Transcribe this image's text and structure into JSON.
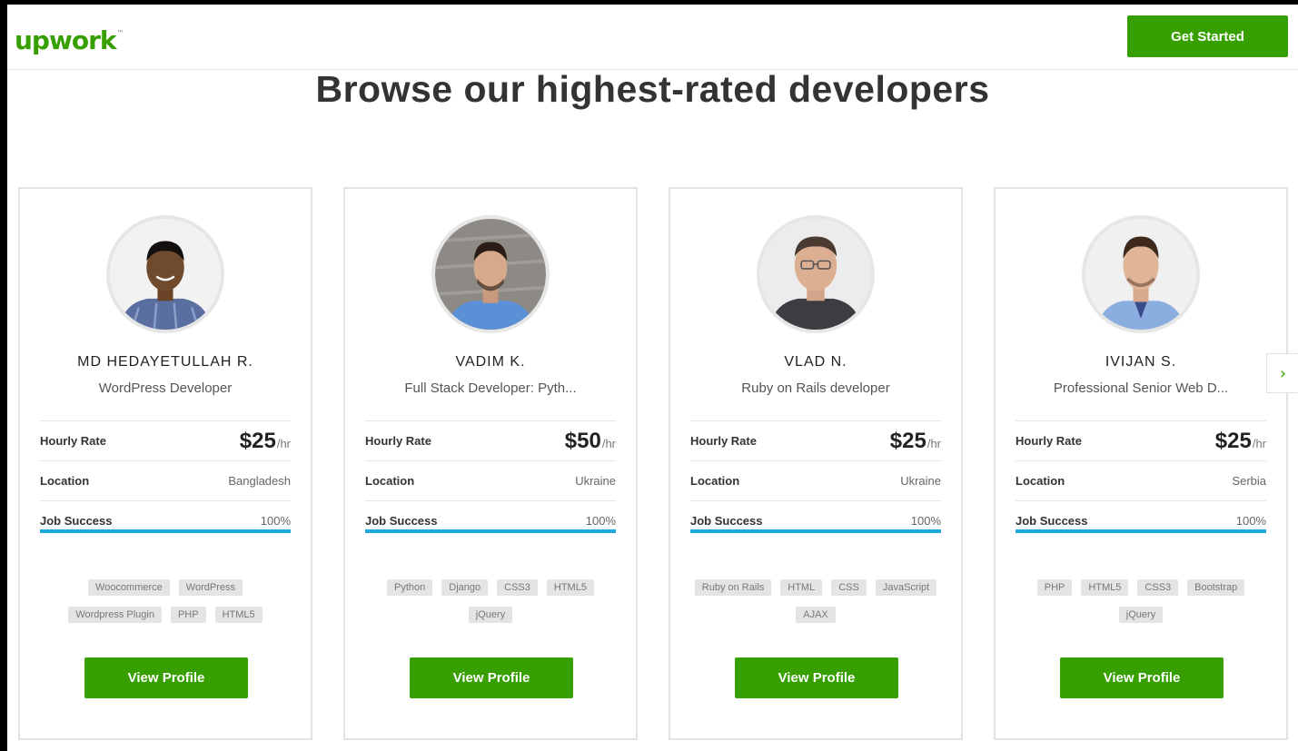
{
  "header": {
    "logo_text": "upwork",
    "logo_tm": "™",
    "cta_label": "Get Started"
  },
  "title": "Browse our highest-rated developers",
  "labels": {
    "hourly_rate": "Hourly Rate",
    "location": "Location",
    "job_success": "Job Success",
    "per_hour": "/hr",
    "view_profile": "View Profile"
  },
  "carousel": {
    "next_glyph": "›"
  },
  "developers": [
    {
      "name": "MD HEDAYETULLAH R.",
      "role": "WordPress Developer",
      "rate": "$25",
      "location": "Bangladesh",
      "job_success": "100%",
      "job_success_fraction": 1.0,
      "skills": [
        "Woocommerce",
        "WordPress",
        "Wordpress Plugin",
        "PHP",
        "HTML5"
      ]
    },
    {
      "name": "VADIM K.",
      "role": "Full Stack Developer: Pyth...",
      "rate": "$50",
      "location": "Ukraine",
      "job_success": "100%",
      "job_success_fraction": 1.0,
      "skills": [
        "Python",
        "Django",
        "CSS3",
        "HTML5",
        "jQuery"
      ]
    },
    {
      "name": "VLAD N.",
      "role": "Ruby on Rails developer",
      "rate": "$25",
      "location": "Ukraine",
      "job_success": "100%",
      "job_success_fraction": 1.0,
      "skills": [
        "Ruby on Rails",
        "HTML",
        "CSS",
        "JavaScript",
        "AJAX"
      ]
    },
    {
      "name": "IVIJAN S.",
      "role": "Professional Senior Web D...",
      "rate": "$25",
      "location": "Serbia",
      "job_success": "100%",
      "job_success_fraction": 1.0,
      "skills": [
        "PHP",
        "HTML5",
        "CSS3",
        "Bootstrap",
        "jQuery"
      ]
    }
  ],
  "colors": {
    "brand_green": "#37a000",
    "progress_blue": "#1fa8e0"
  }
}
